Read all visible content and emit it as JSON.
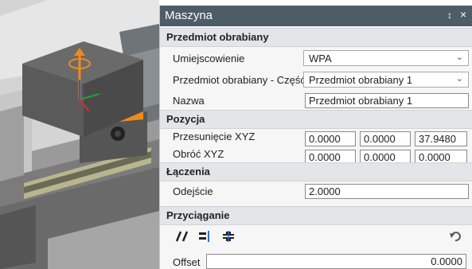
{
  "panel": {
    "title": "Maszyna",
    "pin_glyph": "ₕ",
    "close_glyph": "×"
  },
  "workpiece": {
    "section": "Przedmiot obrabiany",
    "location_label": "Umiejscowienie",
    "location_value": "WPA",
    "part_label": "Przedmiot obrabiany - Część",
    "part_value": "Przedmiot obrabiany 1",
    "name_label": "Nazwa",
    "name_value": "Przedmiot obrabiany 1"
  },
  "position": {
    "section": "Pozycja",
    "offset_label": "Przesunięcie XYZ",
    "offset_values": [
      "0.0000",
      "0.0000",
      "37.9480"
    ],
    "rotate_label": "Obróć XYZ",
    "rotate_values": [
      "0.0000",
      "0.0000",
      "0.0000"
    ]
  },
  "connections": {
    "section": "Łączenia",
    "departure_label": "Odejście",
    "departure_value": "2.0000"
  },
  "snapping": {
    "section": "Przyciąganie",
    "tools": [
      "parallel-icon",
      "align-edge-icon",
      "align-center-icon",
      "undo-icon"
    ],
    "offset_label": "Offset",
    "offset_value": "0.0000"
  },
  "colors": {
    "titlebar": "#4e5c68",
    "section_bg": "#e3e5e8",
    "panel_bg": "#f6f6f6",
    "gizmo_orange": "#f08a1c"
  }
}
